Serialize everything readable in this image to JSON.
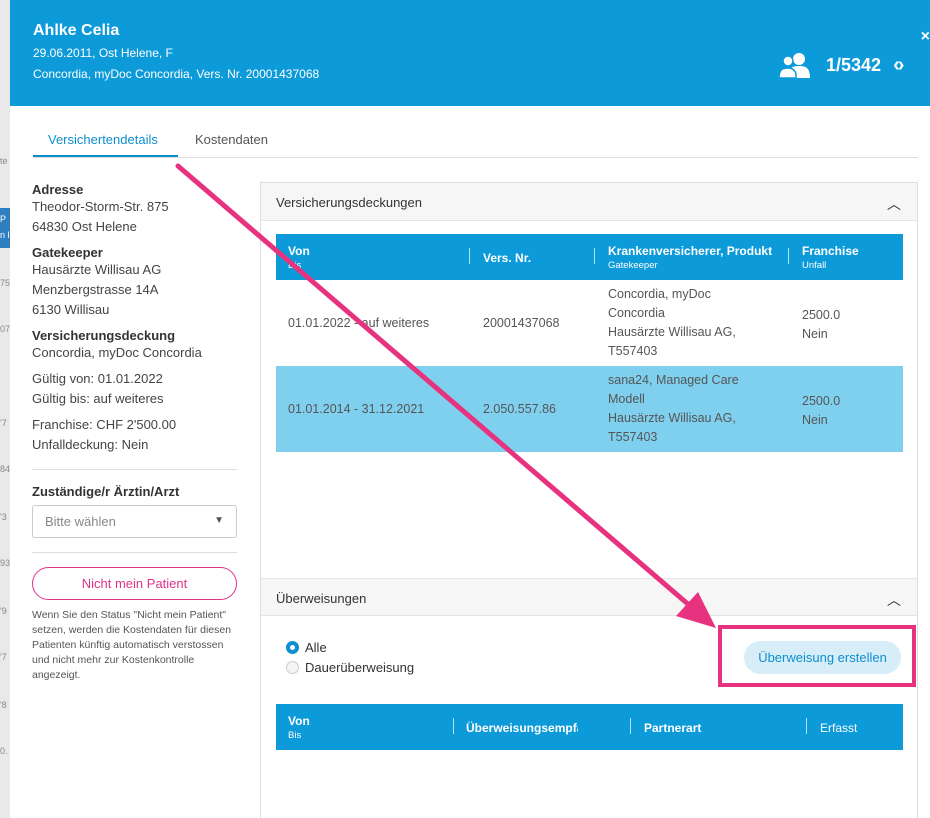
{
  "background": {
    "strip_texts": [
      "te",
      "P",
      "n l",
      "75",
      "07",
      "'7",
      "84",
      "'3",
      "93",
      "'9",
      "'7",
      "'8",
      "0."
    ]
  },
  "header": {
    "name": "Ahlke Celia",
    "line1": "29.06.2011, Ost Helene, F",
    "line2": "Concordia, myDoc Concordia, Vers. Nr. 20001437068",
    "counter": "1/5342",
    "close": "×",
    "nav": "‹›"
  },
  "tabs": [
    "Versichertendetails",
    "Kostendaten"
  ],
  "details": {
    "address_label": "Adresse",
    "address_street": "Theodor-Storm-Str. 875",
    "address_city": "64830 Ost Helene",
    "gatekeeper_label": "Gatekeeper",
    "gatekeeper_name": "Hausärzte Willisau AG",
    "gatekeeper_street": "Menzbergstrasse 14A",
    "gatekeeper_city": "6130 Willisau",
    "coverage_label": "Versicherungsdeckung",
    "coverage_value": "Concordia, myDoc Concordia",
    "valid_from": "Gültig von: 01.01.2022",
    "valid_to": "Gültig bis: auf weiteres",
    "franchise": "Franchise: CHF 2'500.00",
    "accident": "Unfalldeckung: Nein"
  },
  "doctor": {
    "label": "Zuständige/r Ärztin/Arzt",
    "placeholder": "Bitte wählen"
  },
  "not_my_patient": {
    "button": "Nicht mein Patient",
    "note": "Wenn Sie den Status \"Nicht mein Patient\" setzen, werden die Kostendaten für diesen Patienten künftig automatisch verstossen und nicht mehr zur Kostenkontrolle angezeigt."
  },
  "coverages": {
    "title": "Versicherungsdeckungen",
    "columns": [
      {
        "main": "Von",
        "sub": "Bis"
      },
      {
        "main": "Vers. Nr.",
        "sub": ""
      },
      {
        "main": "Krankenversicherer, Produkt",
        "sub": "Gatekeeper"
      },
      {
        "main": "Franchise",
        "sub": "Unfall"
      }
    ],
    "rows": [
      {
        "period": "01.01.2022 - auf weiteres",
        "nr": "20001437068",
        "product": [
          "Concordia, myDoc",
          "Concordia",
          "Hausärzte Willisau AG,",
          "T557403"
        ],
        "franchise": "2500.0",
        "accident": "Nein",
        "selected": false
      },
      {
        "period": "01.01.2014 - 31.12.2021",
        "nr": "2.050.557.86",
        "product": [
          "sana24, Managed Care",
          "Modell",
          "Hausärzte Willisau AG,",
          "T557403"
        ],
        "franchise": "2500.0",
        "accident": "Nein",
        "selected": true
      }
    ]
  },
  "referrals": {
    "title": "Überweisungen",
    "filter_all": "Alle",
    "filter_permanent": "Dauerüberweisung",
    "create_button": "Überweisung erstellen",
    "columns": [
      {
        "main": "Von",
        "sub": "Bis"
      },
      {
        "main": "Überweisungsempfänger",
        "sub": ""
      },
      {
        "main": "Partnerart",
        "sub": ""
      },
      {
        "main": "Erfasst",
        "sub": ""
      }
    ]
  },
  "colors": {
    "header": "#0d9ad9",
    "accent": "#0d8fcf",
    "selected_row": "#7fd0ee",
    "annotation": "#e7337f"
  }
}
